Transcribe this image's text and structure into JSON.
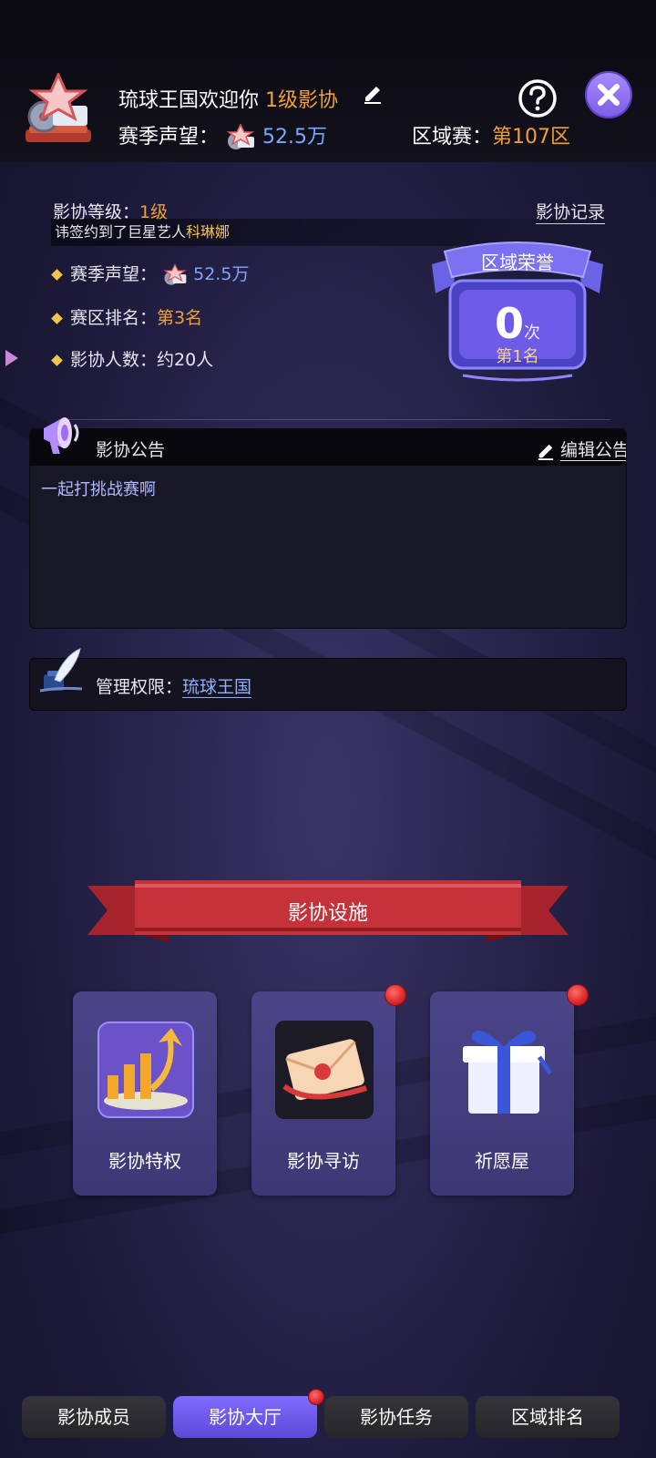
{
  "header": {
    "welcome": "琉球王国欢迎你",
    "level_badge": "1级影协",
    "reputation_label": "赛季声望：",
    "reputation_value": "52.5万",
    "region_label": "区域赛：",
    "region_value": "第107区"
  },
  "info": {
    "level_label": "影协等级：",
    "level_value": "1级",
    "records_link": "影协记录",
    "ticker_prefix": "讳签约到了巨星艺人",
    "ticker_name": "科琳娜",
    "stats": [
      {
        "label": "赛季声望：",
        "value": "52.5万"
      },
      {
        "label": "赛区排名：",
        "value": "第3名"
      },
      {
        "label": "影协人数：",
        "value": "约20人"
      }
    ]
  },
  "honor": {
    "title": "区域荣誉",
    "count": "0",
    "unit": "次",
    "rank": "第1名"
  },
  "notice": {
    "label": "影协公告",
    "edit_label": "编辑公告",
    "content": "一起打挑战赛啊"
  },
  "permission": {
    "label": "管理权限：",
    "value": "琉球王国"
  },
  "facilities": {
    "title": "影协设施",
    "items": [
      {
        "label": "影协特权",
        "badge": false
      },
      {
        "label": "影协寻访",
        "badge": true
      },
      {
        "label": "祈愿屋",
        "badge": true
      }
    ]
  },
  "tabs": [
    {
      "label": "影协成员",
      "active": false,
      "badge": false
    },
    {
      "label": "影协大厅",
      "active": true,
      "badge": true
    },
    {
      "label": "影协任务",
      "active": false,
      "badge": false
    },
    {
      "label": "区域排名",
      "active": false,
      "badge": false
    }
  ],
  "colors": {
    "accent_gold": "#f0a038",
    "accent_blue": "#7aa8ff",
    "tab_active": "#6a58e8",
    "badge_red": "#d41e1e"
  }
}
